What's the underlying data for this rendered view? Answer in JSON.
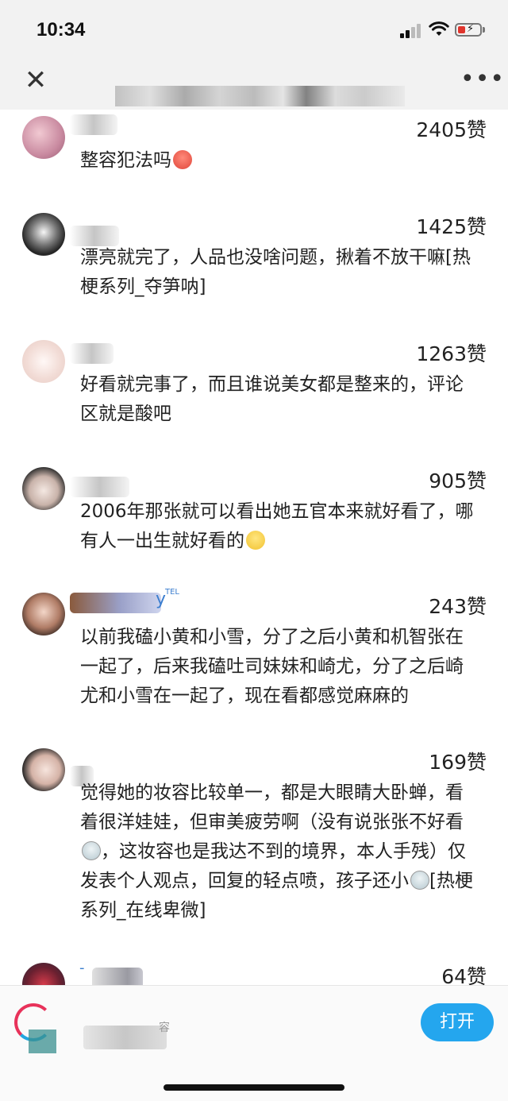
{
  "status_bar": {
    "time": "10:34"
  },
  "nav": {
    "close_symbol": "✕",
    "more_symbol": "•••"
  },
  "comments": [
    {
      "likes": "2405赞",
      "text": "整容犯法吗",
      "emoji": "angry-face-icon"
    },
    {
      "likes": "1425赞",
      "text": "漂亮就完了，人品也没啥问题，揪着不放干嘛[热梗系列_夺笋呐]"
    },
    {
      "likes": "1263赞",
      "text": "好看就完事了，而且谁说美女都是整来的，评论区就是酸吧"
    },
    {
      "likes": "905赞",
      "text": "2006年那张就可以看出她五官本来就好看了，哪有人一出生就好看的",
      "emoji": "smug-face-icon"
    },
    {
      "likes": "243赞",
      "name_suffix": "y",
      "name_badge": "TEL",
      "text": "以前我磕小黄和小雪，分了之后小黄和机智张在一起了，后来我磕吐司妹妹和崎尤，分了之后崎尤和小雪在一起了，现在看都感觉麻麻的"
    },
    {
      "likes": "169赞",
      "text_part1": "觉得她的妆容比较单一，都是大眼睛大卧蝉，看着很洋娃娃，但审美疲劳啊（没有说张张不好看",
      "text_part2": "，这妆容也是我达不到的境界，本人手残）仅发表个人观点，回复的轻点喷，孩子还小",
      "text_part3": "[热梗系列_在线卑微]"
    },
    {
      "likes": "64赞",
      "name_prefix": "-"
    }
  ],
  "bottom_bar": {
    "open_button": "打开",
    "partial_text": "容"
  },
  "colors": {
    "accent": "#24a6ee",
    "background": "#ffffff",
    "bar": "#f2f2f2"
  }
}
